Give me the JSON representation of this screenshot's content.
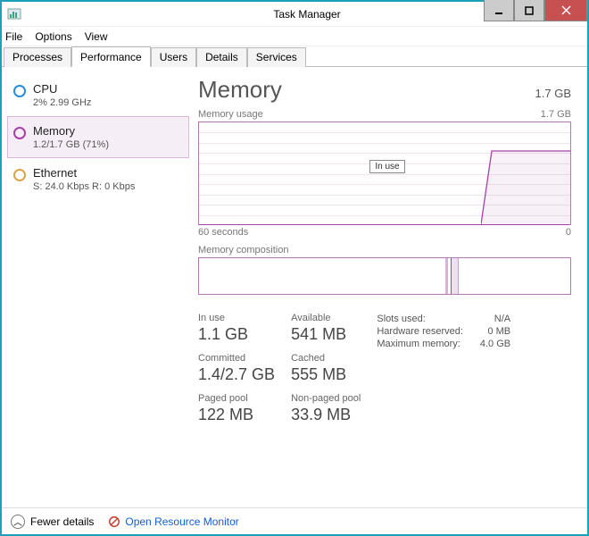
{
  "window": {
    "title": "Task Manager"
  },
  "menu": {
    "file": "File",
    "options": "Options",
    "view": "View"
  },
  "tabs": {
    "processes": "Processes",
    "performance": "Performance",
    "users": "Users",
    "details": "Details",
    "services": "Services"
  },
  "sidebar": {
    "cpu": {
      "title": "CPU",
      "sub": "2%  2.99 GHz"
    },
    "memory": {
      "title": "Memory",
      "sub": "1.2/1.7 GB (71%)"
    },
    "ethernet": {
      "title": "Ethernet",
      "sub": "S: 24.0 Kbps  R: 0 Kbps"
    }
  },
  "main": {
    "title": "Memory",
    "total": "1.7 GB",
    "usage_label": "Memory usage",
    "usage_right": "1.7 GB",
    "inuse_tag": "In use",
    "axis_left": "60 seconds",
    "axis_right": "0",
    "composition_label": "Memory composition",
    "stats": {
      "inuse": {
        "label": "In use",
        "val": "1.1 GB"
      },
      "available": {
        "label": "Available",
        "val": "541 MB"
      },
      "committed": {
        "label": "Committed",
        "val": "1.4/2.7 GB"
      },
      "cached": {
        "label": "Cached",
        "val": "555 MB"
      },
      "paged": {
        "label": "Paged pool",
        "val": "122 MB"
      },
      "nonpaged": {
        "label": "Non-paged pool",
        "val": "33.9 MB"
      }
    },
    "info": {
      "slots_label": "Slots used:",
      "slots_val": "N/A",
      "hw_label": "Hardware reserved:",
      "hw_val": "0 MB",
      "max_label": "Maximum memory:",
      "max_val": "4.0 GB"
    }
  },
  "footer": {
    "fewer": "Fewer details",
    "resmon": "Open Resource Monitor"
  },
  "chart_data": {
    "type": "line",
    "title": "Memory usage",
    "xlabel": "seconds",
    "ylabel": "GB",
    "xlim": [
      60,
      0
    ],
    "ylim": [
      0,
      1.7
    ],
    "series": [
      {
        "name": "In use",
        "x": [
          60,
          15,
          12,
          0
        ],
        "values": [
          0,
          0,
          1.2,
          1.2
        ]
      }
    ]
  }
}
